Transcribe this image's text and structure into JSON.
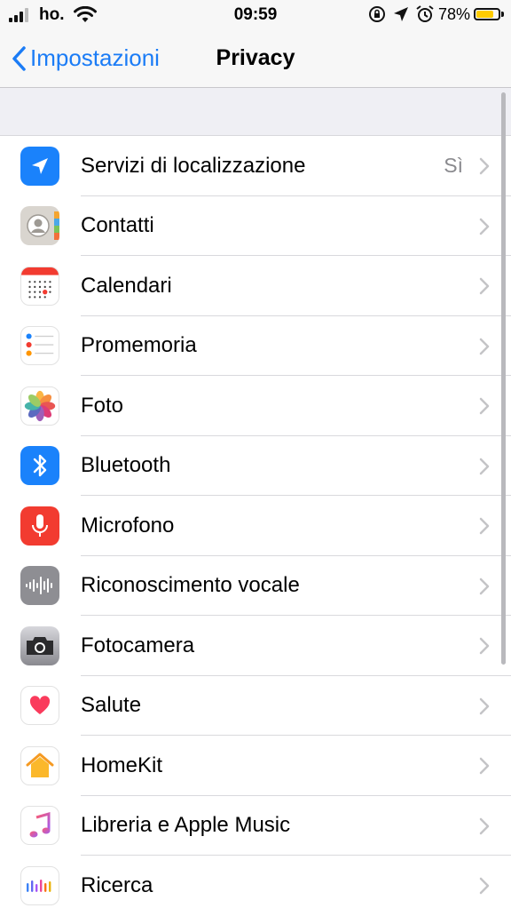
{
  "status_bar": {
    "carrier": "ho.",
    "time": "09:59",
    "battery_percent": "78%",
    "battery_level": 0.78,
    "battery_color": "#ffcc00"
  },
  "nav": {
    "back_label": "Impostazioni",
    "title": "Privacy",
    "accent_color": "#1b7cf6"
  },
  "items": [
    {
      "label": "Servizi di localizzazione",
      "value": "Sì",
      "icon": "location-arrow-icon"
    },
    {
      "label": "Contatti",
      "value": "",
      "icon": "contacts-icon"
    },
    {
      "label": "Calendari",
      "value": "",
      "icon": "calendar-icon"
    },
    {
      "label": "Promemoria",
      "value": "",
      "icon": "reminders-icon"
    },
    {
      "label": "Foto",
      "value": "",
      "icon": "photos-icon"
    },
    {
      "label": "Bluetooth",
      "value": "",
      "icon": "bluetooth-icon"
    },
    {
      "label": "Microfono",
      "value": "",
      "icon": "microphone-icon"
    },
    {
      "label": "Riconoscimento vocale",
      "value": "",
      "icon": "speech-recognition-icon"
    },
    {
      "label": "Fotocamera",
      "value": "",
      "icon": "camera-icon"
    },
    {
      "label": "Salute",
      "value": "",
      "icon": "health-heart-icon"
    },
    {
      "label": "HomeKit",
      "value": "",
      "icon": "homekit-icon"
    },
    {
      "label": "Libreria e Apple Music",
      "value": "",
      "icon": "music-note-icon"
    },
    {
      "label": "Ricerca",
      "value": "",
      "icon": "research-icon"
    }
  ]
}
